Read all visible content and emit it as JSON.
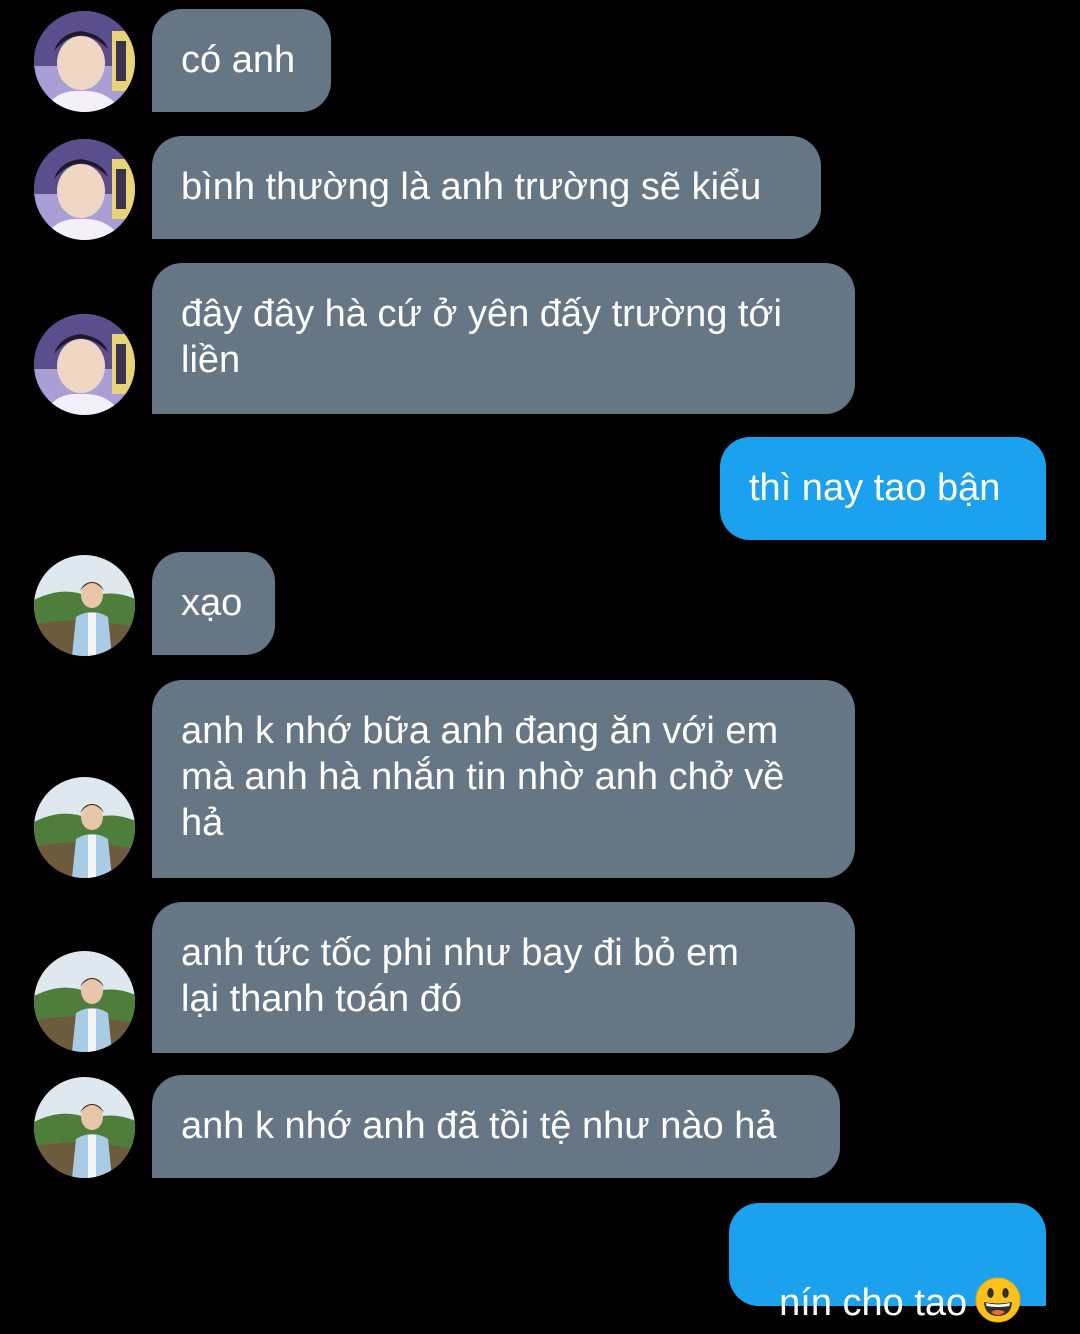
{
  "conversation": {
    "messages": [
      {
        "from": "other",
        "text": "có anh"
      },
      {
        "from": "other",
        "text": "bình thường là anh trường sẽ kiểu"
      },
      {
        "from": "other",
        "text": "đây đây hà cứ ở yên đấy trường tới\nliền"
      },
      {
        "from": "me",
        "text": "thì nay tao bận"
      },
      {
        "from": "other",
        "text": "xạo"
      },
      {
        "from": "other",
        "text": "anh k nhớ bữa anh đang ăn với em\nmà anh hà nhắn tin nhờ anh chở về\nhả"
      },
      {
        "from": "other",
        "text": "anh tức tốc phi như bay đi bỏ em\nlại thanh toán đó"
      },
      {
        "from": "other",
        "text": "anh k nhớ anh đã tồi tệ như nào hả"
      },
      {
        "from": "me",
        "text": "nín cho tao",
        "emoji": "grinning-face-emoji"
      }
    ]
  },
  "colors": {
    "background": "#000000",
    "received_bubble": "#677684",
    "sent_bubble": "#1ca1ef",
    "text": "#ffffff"
  }
}
